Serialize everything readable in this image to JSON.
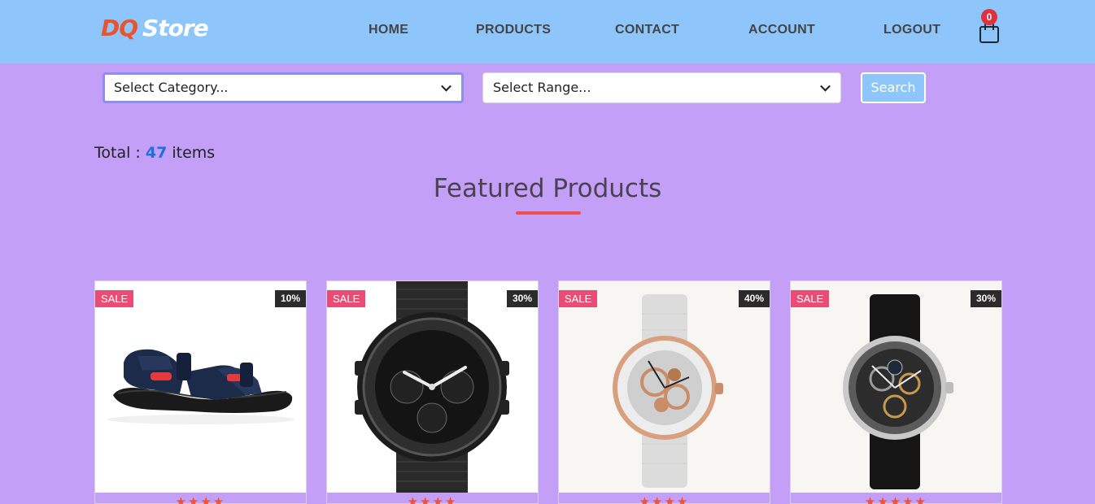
{
  "header": {
    "logo_part1": "DQ",
    "logo_part2": "Store",
    "nav": [
      "HOME",
      "PRODUCTS",
      "CONTACT",
      "ACCOUNT",
      "LOGOUT"
    ],
    "cart_count": "0"
  },
  "filters": {
    "category_value": "Select Category...",
    "range_value": "Select Range...",
    "search_label": "Search"
  },
  "summary": {
    "prefix": "Total :",
    "count": "47",
    "suffix": "items"
  },
  "section_title": "Featured Products",
  "products": [
    {
      "sale": "SALE",
      "discount": "10%",
      "image": "sandal",
      "rating": 4
    },
    {
      "sale": "SALE",
      "discount": "30%",
      "image": "black-chronograph-watch",
      "rating": 4
    },
    {
      "sale": "SALE",
      "discount": "40%",
      "image": "rose-gold-skeleton-watch",
      "rating": 4
    },
    {
      "sale": "SALE",
      "discount": "30%",
      "image": "silver-skeleton-watch",
      "rating": 5
    }
  ],
  "colors": {
    "header_bg": "#8ec5fb",
    "page_bg": "#c39ff7",
    "accent_red": "#f04e4e",
    "sale_badge": "#e94d76",
    "count_blue": "#1f6fe0"
  }
}
